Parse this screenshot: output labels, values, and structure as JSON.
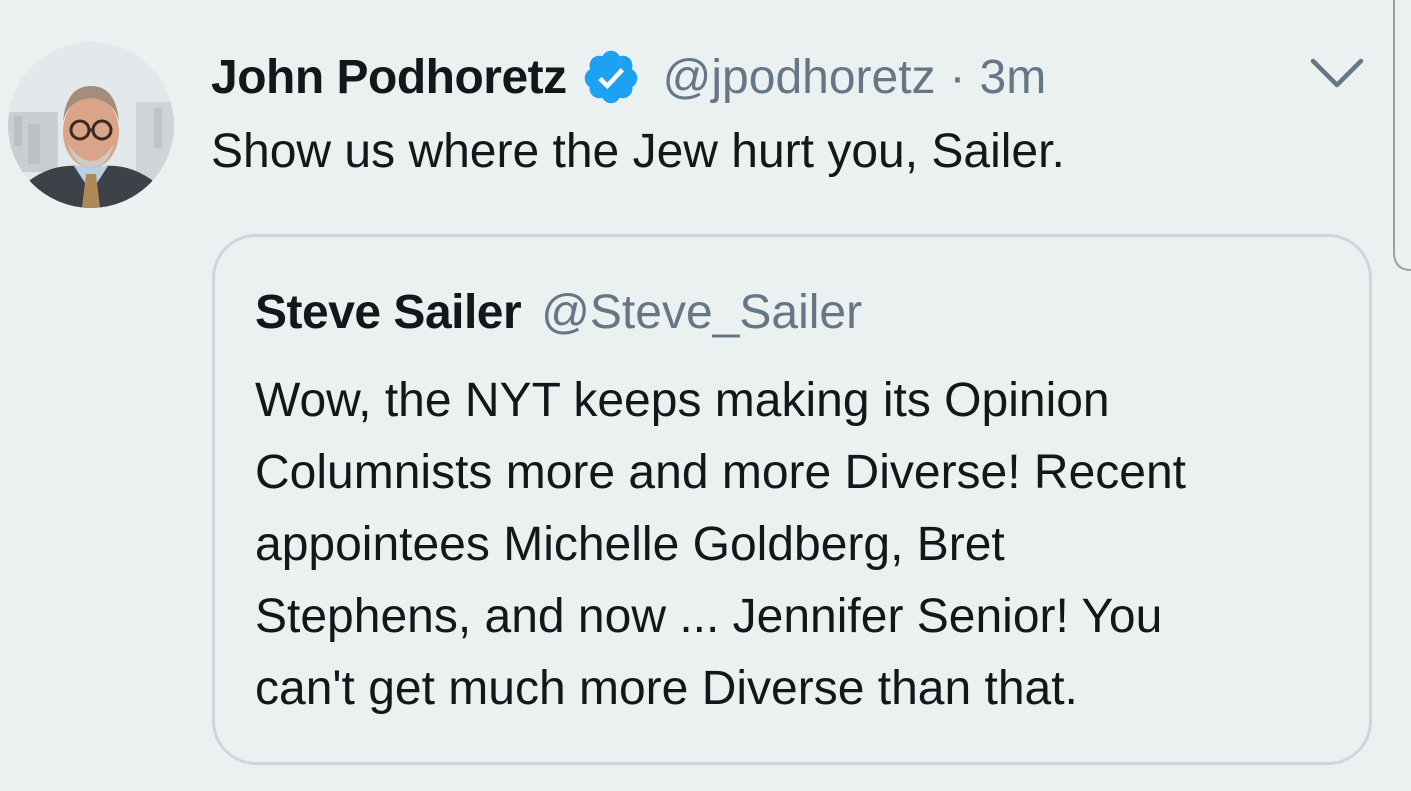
{
  "tweet": {
    "author": {
      "display_name": "John Podhoretz",
      "handle": "@jpodhoretz",
      "verified": true
    },
    "separator": "·",
    "timestamp": "3m",
    "text": "Show us where the Jew hurt you, Sailer.",
    "quoted_tweet": {
      "author": {
        "display_name": "Steve Sailer",
        "handle": "@Steve_Sailer"
      },
      "text_lines": [
        "Wow, the NYT keeps making its Opinion",
        "Columnists more and more Diverse! Recent",
        "appointees Michelle Goldberg, Bret",
        "Stephens, and now ... Jennifer Senior! You",
        "can't get much more Diverse than that."
      ]
    }
  },
  "icons": {
    "verified": "verified-badge-icon",
    "menu": "chevron-down-icon"
  },
  "colors": {
    "background": "#ebf1f1",
    "primary_text": "#14171a",
    "secondary_text": "#657786",
    "verified_blue": "#1da1f2",
    "card_border": "#ccd6dd"
  }
}
